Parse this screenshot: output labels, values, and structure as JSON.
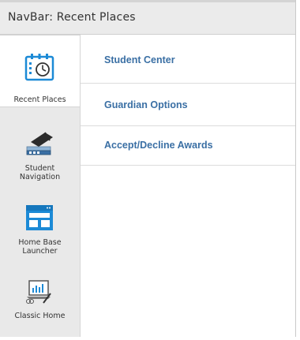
{
  "navbar": {
    "title": "NavBar: Recent Places",
    "sidebar": {
      "items": [
        {
          "label": "Recent Places",
          "icon": "calendar-clock-icon",
          "active": true
        },
        {
          "label": "Student Navigation",
          "icon": "graduation-books-icon",
          "active": false
        },
        {
          "label": "Home Base Launcher",
          "icon": "window-grid-icon",
          "active": false
        },
        {
          "label": "Classic Home",
          "icon": "chart-laptop-icon",
          "active": false
        }
      ]
    },
    "links": [
      {
        "label": "Student Center"
      },
      {
        "label": "Guardian Options"
      },
      {
        "label": "Accept/Decline Awards"
      }
    ]
  },
  "colors": {
    "link": "#3a6fa4",
    "accent_blue": "#1c8ad6",
    "sidebar_bg": "#e9e9e9",
    "header_bg": "#ebebeb"
  }
}
